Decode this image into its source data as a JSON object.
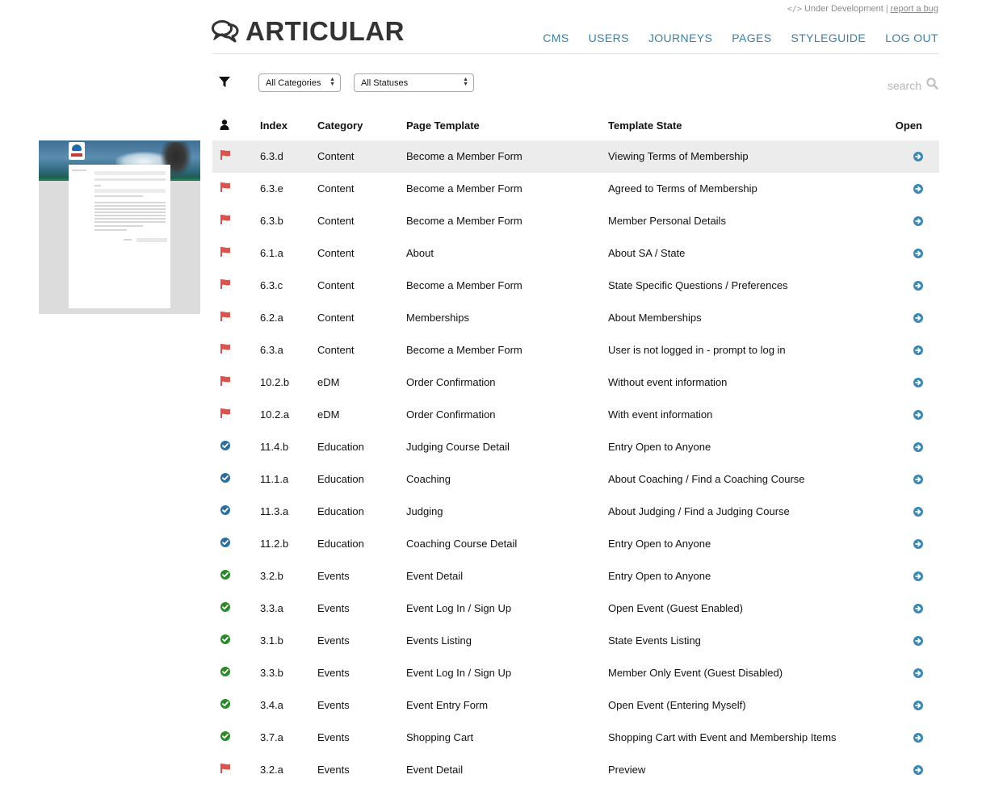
{
  "topbar": {
    "dev_icon": "</>",
    "dev_status": "Under Development",
    "separator": "|",
    "report_link": "report a bug"
  },
  "header": {
    "logo_icon": "speech-bubbles-icon",
    "app_name": "ARTICULAR",
    "nav": [
      "CMS",
      "USERS",
      "JOURNEYS",
      "PAGES",
      "STYLEGUIDE",
      "LOG OUT"
    ]
  },
  "filters": {
    "filter_icon": "filter-icon",
    "category": "All Categories",
    "status": "All Statuses",
    "search_placeholder": "search",
    "search_icon": "magnifier-icon"
  },
  "colors": {
    "accent": "#3c7fa6",
    "flag_red": "#d9534f",
    "check_blue": "#2a6fa0",
    "check_green": "#2a8a2a",
    "open_arrow": "#3a88b3",
    "selected_row": "#ececec"
  },
  "table": {
    "headers": {
      "user_icon": "person-icon",
      "index": "Index",
      "category": "Category",
      "template": "Page Template",
      "state": "Template State",
      "open": "Open"
    },
    "rows": [
      {
        "status": "flag",
        "index": "6.3.d",
        "category": "Content",
        "template": "Become a Member Form",
        "state": "Viewing Terms of Membership",
        "selected": true
      },
      {
        "status": "flag",
        "index": "6.3.e",
        "category": "Content",
        "template": "Become a Member Form",
        "state": "Agreed to Terms of Membership"
      },
      {
        "status": "flag",
        "index": "6.3.b",
        "category": "Content",
        "template": "Become a Member Form",
        "state": "Member Personal Details"
      },
      {
        "status": "flag",
        "index": "6.1.a",
        "category": "Content",
        "template": "About",
        "state": "About SA / State"
      },
      {
        "status": "flag",
        "index": "6.3.c",
        "category": "Content",
        "template": "Become a Member Form",
        "state": "State Specific Questions / Preferences"
      },
      {
        "status": "flag",
        "index": "6.2.a",
        "category": "Content",
        "template": "Memberships",
        "state": "About Memberships"
      },
      {
        "status": "flag",
        "index": "6.3.a",
        "category": "Content",
        "template": "Become a Member Form",
        "state": "User is not logged in - prompt to log in"
      },
      {
        "status": "flag",
        "index": "10.2.b",
        "category": "eDM",
        "template": "Order Confirmation",
        "state": "Without event information"
      },
      {
        "status": "flag",
        "index": "10.2.a",
        "category": "eDM",
        "template": "Order Confirmation",
        "state": "With event information"
      },
      {
        "status": "check-blue",
        "index": "11.4.b",
        "category": "Education",
        "template": "Judging Course Detail",
        "state": "Entry Open to Anyone"
      },
      {
        "status": "check-blue",
        "index": "11.1.a",
        "category": "Education",
        "template": "Coaching",
        "state": "About Coaching / Find a Coaching Course"
      },
      {
        "status": "check-blue",
        "index": "11.3.a",
        "category": "Education",
        "template": "Judging",
        "state": "About Judging / Find a Judging Course"
      },
      {
        "status": "check-blue",
        "index": "11.2.b",
        "category": "Education",
        "template": "Coaching Course Detail",
        "state": "Entry Open to Anyone"
      },
      {
        "status": "check-green",
        "index": "3.2.b",
        "category": "Events",
        "template": "Event Detail",
        "state": "Entry Open to Anyone"
      },
      {
        "status": "check-green",
        "index": "3.3.a",
        "category": "Events",
        "template": "Event Log In / Sign Up",
        "state": "Open Event (Guest Enabled)"
      },
      {
        "status": "check-green",
        "index": "3.1.b",
        "category": "Events",
        "template": "Events Listing",
        "state": "State Events Listing"
      },
      {
        "status": "check-green",
        "index": "3.3.b",
        "category": "Events",
        "template": "Event Log In / Sign Up",
        "state": "Member Only Event (Guest Disabled)"
      },
      {
        "status": "check-green",
        "index": "3.4.a",
        "category": "Events",
        "template": "Event Entry Form",
        "state": "Open Event (Entering Myself)"
      },
      {
        "status": "check-green",
        "index": "3.7.a",
        "category": "Events",
        "template": "Shopping Cart",
        "state": "Shopping Cart with Event and Membership Items"
      },
      {
        "status": "flag",
        "index": "3.2.a",
        "category": "Events",
        "template": "Event Detail",
        "state": "Preview"
      }
    ],
    "open_icon": "arrow-circle-right-icon"
  },
  "preview": {
    "thumbnail_icon": "page-thumbnail"
  }
}
